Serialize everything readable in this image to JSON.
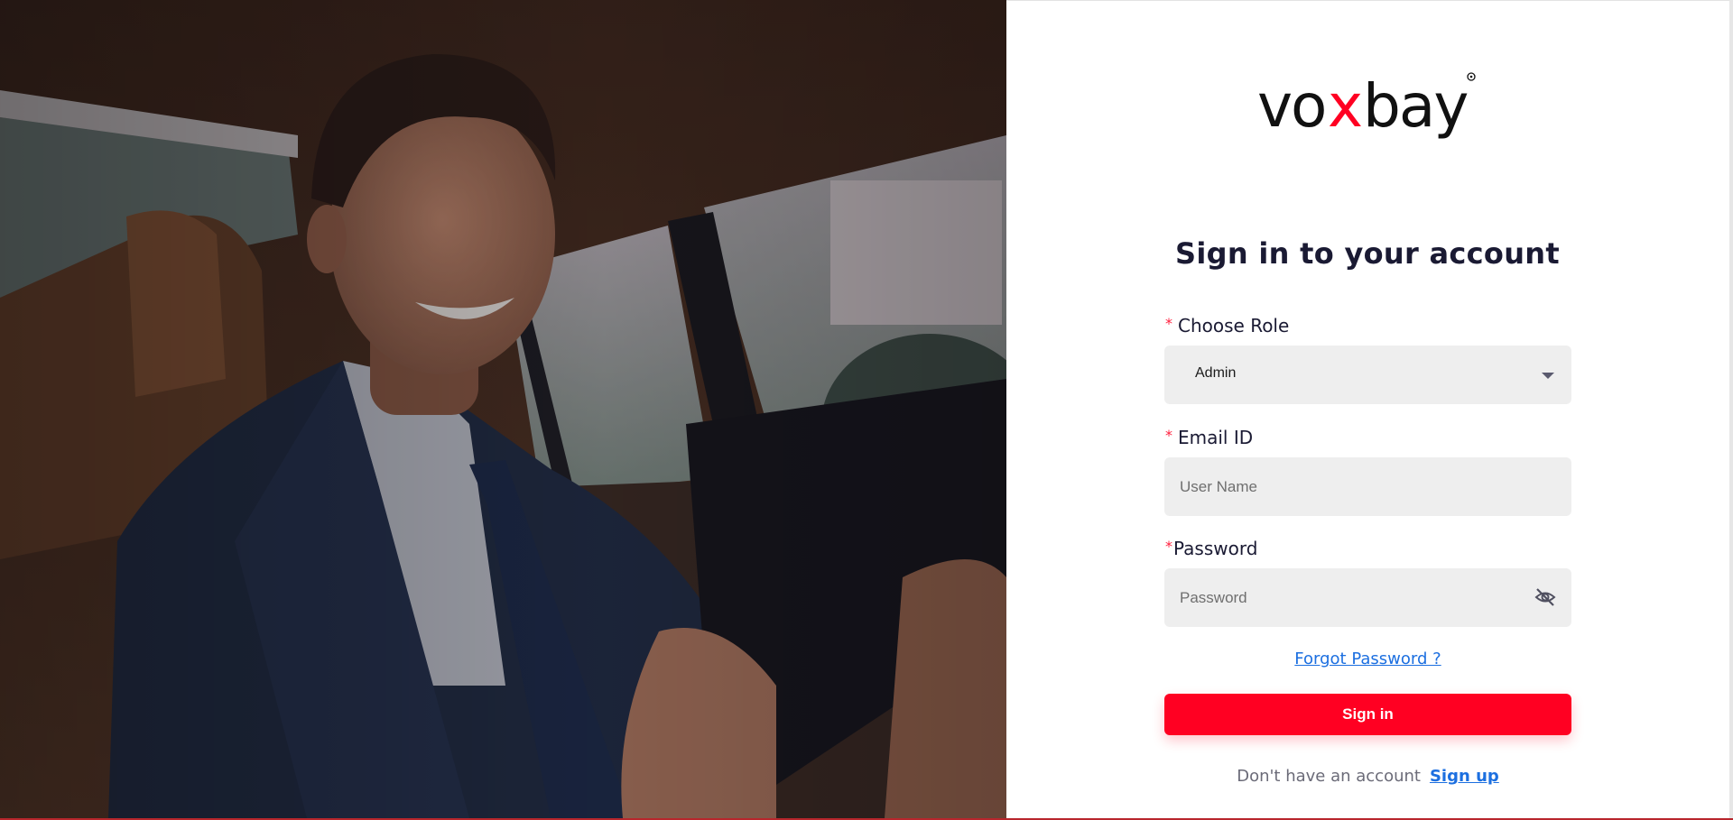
{
  "brand": {
    "name": "voxbay",
    "accent_color": "#ff0022"
  },
  "hero": {
    "image_icon": "photo-hero-icon"
  },
  "form": {
    "title": "Sign in to your account",
    "role": {
      "required_mark": "*",
      "label": "Choose Role",
      "selected": "Admin"
    },
    "email": {
      "required_mark": "*",
      "label": "Email ID",
      "placeholder": "User Name",
      "value": ""
    },
    "password": {
      "required_mark": "*",
      "label": "Password",
      "placeholder": "Password",
      "value": "",
      "toggle_icon": "eye-off-icon"
    },
    "forgot_label": "Forgot Password ?",
    "signin_label": "Sign in",
    "signup_prompt": "Don't have an account",
    "signup_label": "Sign up"
  }
}
